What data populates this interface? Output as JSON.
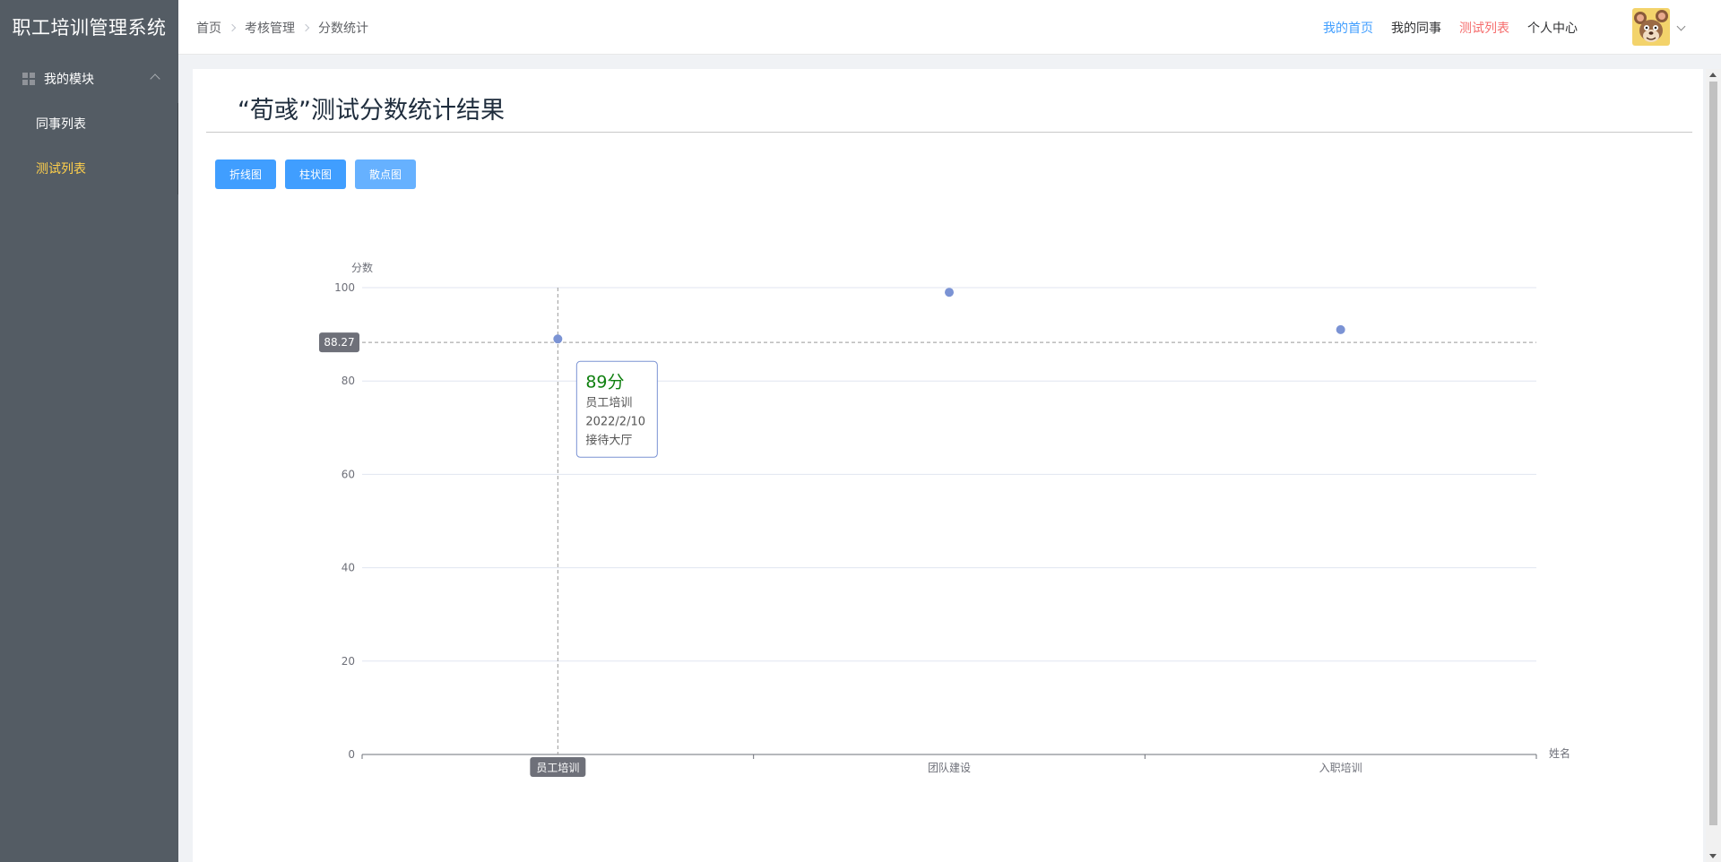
{
  "app": {
    "title": "职工培训管理系统"
  },
  "sidebar": {
    "submenu": {
      "label": "我的模块",
      "icon": "grid-icon",
      "expanded": true
    },
    "items": [
      {
        "label": "同事列表",
        "active": false
      },
      {
        "label": "测试列表",
        "active": true
      }
    ],
    "colors": {
      "background": "#545c64",
      "active_text": "#ffd04b"
    }
  },
  "breadcrumb": [
    "首页",
    "考核管理",
    "分数统计"
  ],
  "topnav": {
    "items": [
      {
        "label": "我的首页",
        "color": "#409eff"
      },
      {
        "label": "我的同事",
        "color": "#303133"
      },
      {
        "label": "测试列表",
        "color": "#f56c6c"
      },
      {
        "label": "个人中心",
        "color": "#303133"
      }
    ],
    "avatar_icon": "mouse-avatar-icon"
  },
  "page": {
    "title": "“荀彧”测试分数统计结果",
    "buttons": [
      "折线图",
      "柱状图",
      "散点图"
    ]
  },
  "chart_data": {
    "type": "scatter",
    "categories": [
      "员工培训",
      "团队建设",
      "入职培训"
    ],
    "values": [
      89,
      99,
      91
    ],
    "xlabel": "姓名",
    "ylabel": "分数",
    "ylim": [
      0,
      100
    ],
    "yticks": [
      0,
      20,
      40,
      60,
      80,
      100
    ],
    "grid": true,
    "point_color": "#7b93d4",
    "hover": {
      "category_index": 0,
      "y_pointer_value": 88.27,
      "y_pointer_label": "88.27",
      "tooltip": {
        "score": "89分",
        "name": "员工培训",
        "date": "2022/2/10",
        "location": "接待大厅"
      }
    }
  }
}
